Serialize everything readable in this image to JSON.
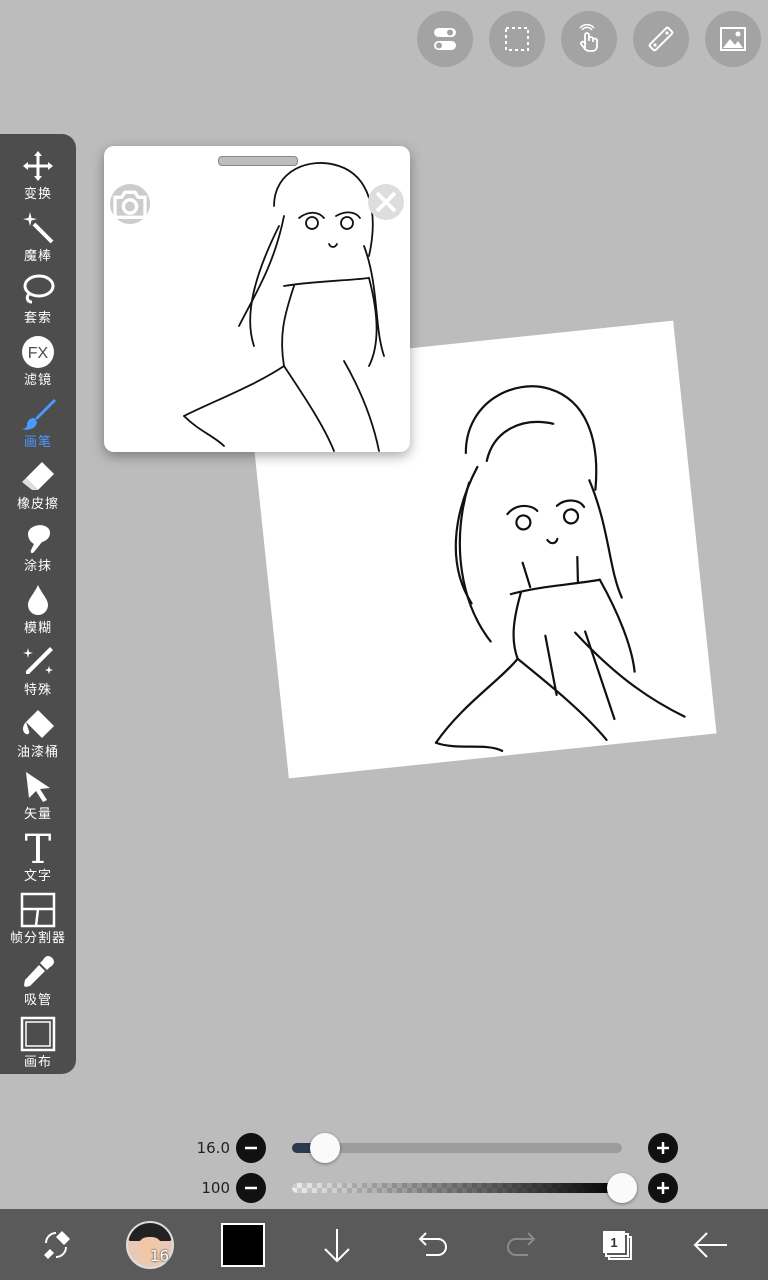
{
  "top_toolbar": {
    "buttons": [
      {
        "icon": "toggle-icon"
      },
      {
        "icon": "selection-icon"
      },
      {
        "icon": "hand-tap-icon"
      },
      {
        "icon": "ruler-icon"
      },
      {
        "icon": "image-icon"
      }
    ]
  },
  "tools": [
    {
      "label": "变换",
      "icon": "move-arrows-icon"
    },
    {
      "label": "魔棒",
      "icon": "magic-wand-icon"
    },
    {
      "label": "套索",
      "icon": "lasso-icon"
    },
    {
      "label": "滤镜",
      "icon": "fx-icon",
      "icon_text": "FX"
    },
    {
      "label": "画笔",
      "icon": "brush-icon",
      "active": true
    },
    {
      "label": "橡皮擦",
      "icon": "eraser-icon"
    },
    {
      "label": "涂抹",
      "icon": "smudge-icon"
    },
    {
      "label": "模糊",
      "icon": "blur-drop-icon"
    },
    {
      "label": "特殊",
      "icon": "special-brush-icon"
    },
    {
      "label": "油漆桶",
      "icon": "paint-bucket-icon"
    },
    {
      "label": "矢量",
      "icon": "vector-cursor-icon"
    },
    {
      "label": "文字",
      "icon": "text-icon",
      "icon_text": "T"
    },
    {
      "label": "帧分割器",
      "icon": "frame-divider-icon"
    },
    {
      "label": "吸管",
      "icon": "eyedropper-icon"
    },
    {
      "label": "画布",
      "icon": "canvas-icon"
    }
  ],
  "sliders": {
    "size": {
      "value": "16.0",
      "fraction": 0.1
    },
    "opacity": {
      "value": "100",
      "fraction": 1.0
    }
  },
  "bottom_bar": {
    "brush_size": "16",
    "color": "#000000",
    "layer_count": "1"
  },
  "colors": {
    "background": "#bcbcbc",
    "panel": "#4d4d4d",
    "active_tool": "#4a9bff",
    "bottom_bar": "#5a5a5a"
  }
}
